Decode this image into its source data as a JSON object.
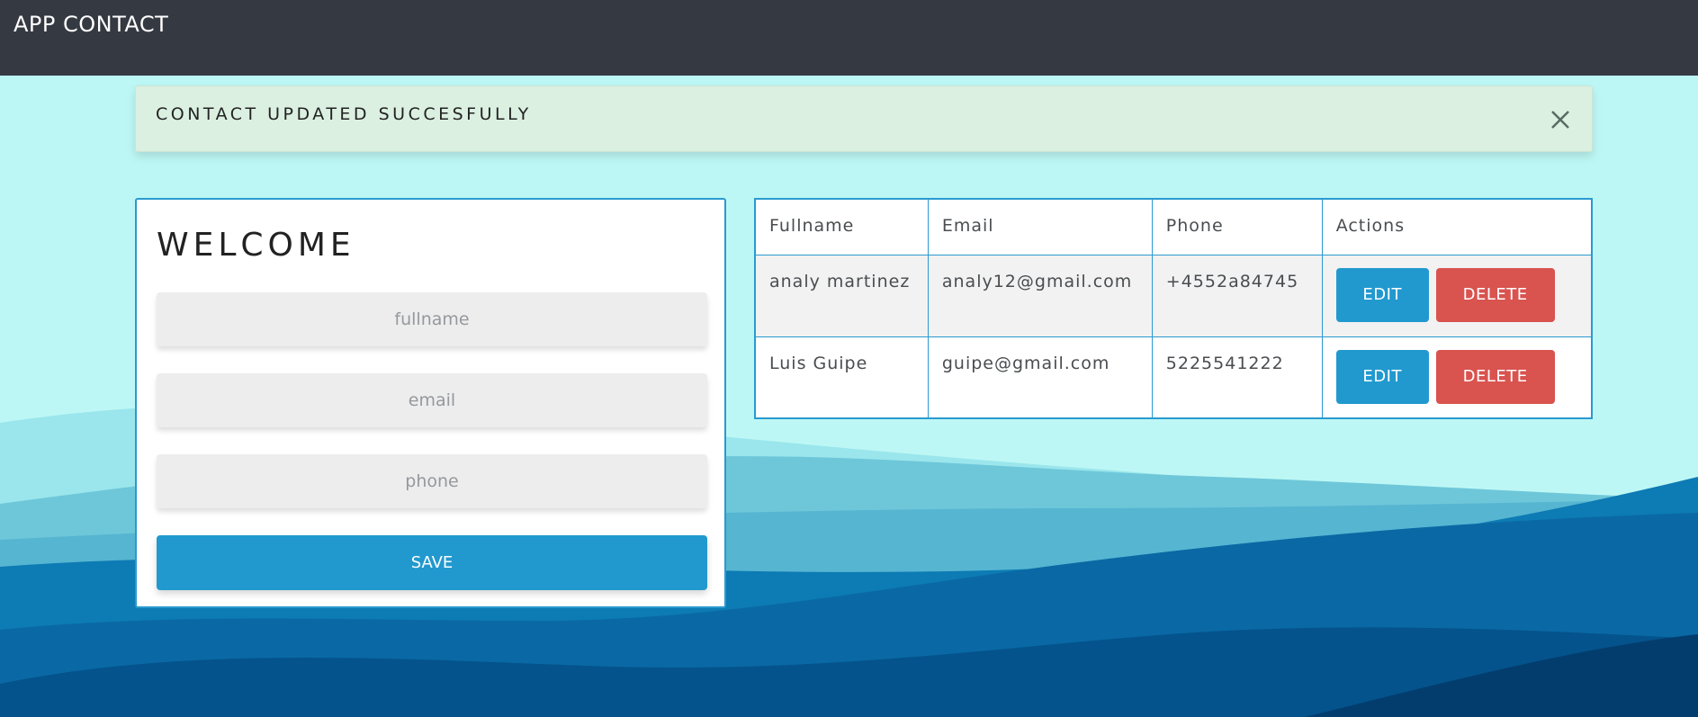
{
  "app": {
    "title": "APP CONTACT"
  },
  "alert": {
    "message": "CONTACT UPDATED SUCCESFULLY",
    "close_icon": "close-icon"
  },
  "form": {
    "title": "WELCOME",
    "fullname_placeholder": "fullname",
    "email_placeholder": "email",
    "phone_placeholder": "phone",
    "save_label": "SAVE"
  },
  "table": {
    "headers": [
      "Fullname",
      "Email",
      "Phone",
      "Actions"
    ],
    "rows": [
      {
        "fullname": "analy martinez",
        "email": "analy12@gmail.com",
        "phone": "+4552a84745",
        "edit_label": "EDIT",
        "delete_label": "DELETE"
      },
      {
        "fullname": "Luis Guipe",
        "email": "guipe@gmail.com",
        "phone": "5225541222",
        "edit_label": "EDIT",
        "delete_label": "DELETE"
      }
    ]
  },
  "colors": {
    "navbar": "#353942",
    "background": "#bdf7f5",
    "alert": "#dbf0e1",
    "primary": "#2199cf",
    "danger": "#d9534f"
  }
}
